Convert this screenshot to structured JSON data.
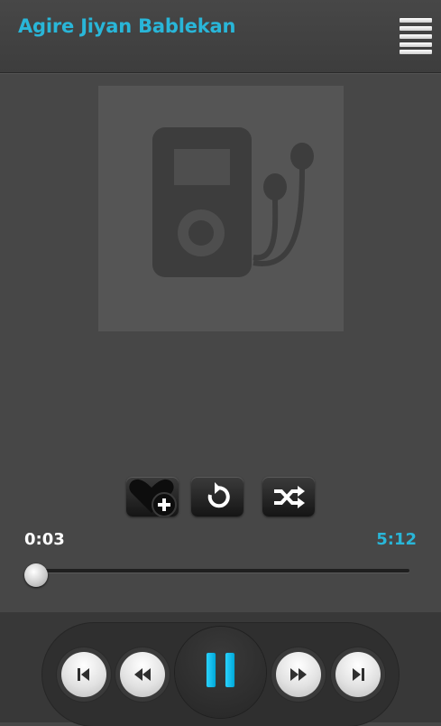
{
  "header": {
    "title": "Agire Jiyan Bablekan",
    "menu_icon": "hamburger-menu-icon"
  },
  "album_art": {
    "icon": "music-player-earphones-icon"
  },
  "controls": {
    "favorite_icon": "heart-add-icon",
    "repeat_icon": "repeat-icon",
    "shuffle_icon": "shuffle-icon"
  },
  "progress": {
    "elapsed": "0:03",
    "total": "5:12",
    "fraction": 0.01
  },
  "transport": {
    "previous_icon": "skip-previous-icon",
    "rewind_icon": "rewind-icon",
    "play_pause_icon": "pause-icon",
    "forward_icon": "fast-forward-icon",
    "next_icon": "skip-next-icon"
  },
  "colors": {
    "accent": "#29b6d8",
    "background": "#474747",
    "text": "#ffffff"
  }
}
